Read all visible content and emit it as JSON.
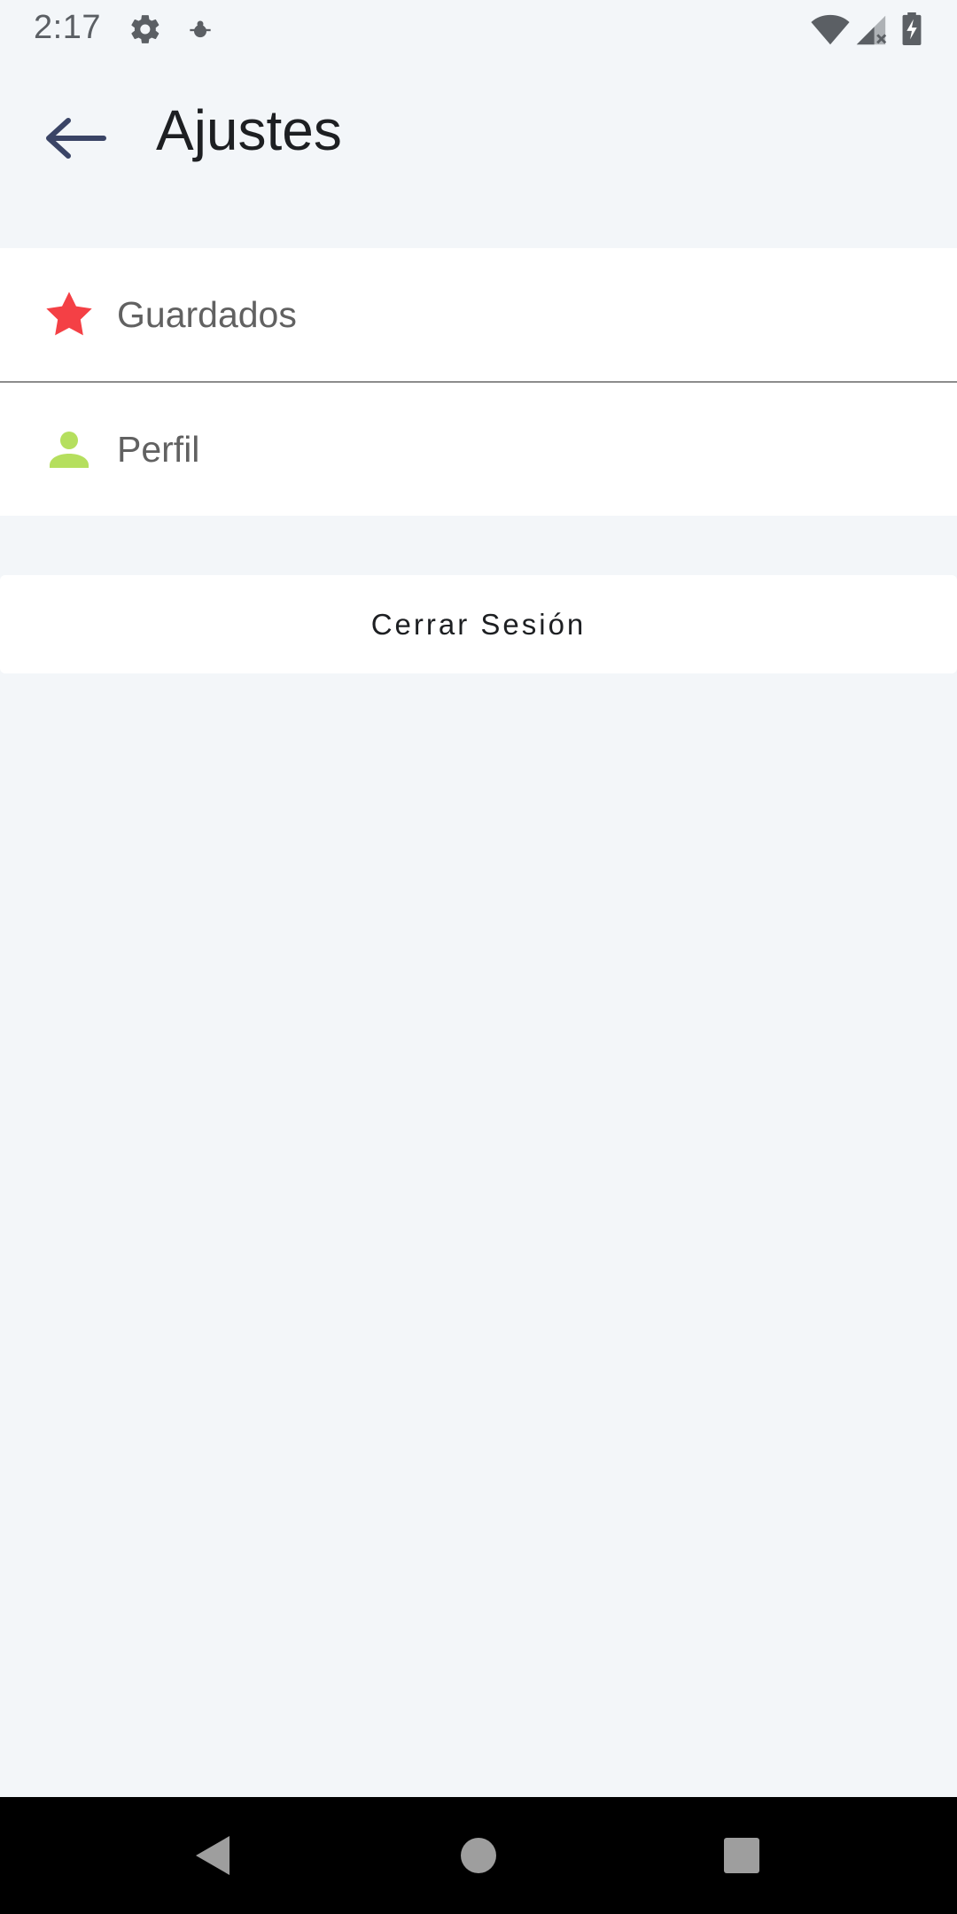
{
  "status_bar": {
    "time": "2:17",
    "icons": [
      "gear-icon",
      "bug-icon",
      "wifi-icon",
      "signal-icon",
      "battery-icon"
    ]
  },
  "app_bar": {
    "title": "Ajustes",
    "back_icon": "arrow-back-icon"
  },
  "menu": {
    "items": [
      {
        "label": "Guardados",
        "icon": "star-icon",
        "icon_color": "#f44045"
      },
      {
        "label": "Perfil",
        "icon": "person-icon",
        "icon_color": "#b5df5e"
      }
    ]
  },
  "logout": {
    "label": "Cerrar Sesión"
  },
  "nav_bar": {
    "buttons": [
      "nav-back-icon",
      "nav-home-icon",
      "nav-recents-icon"
    ]
  },
  "colors": {
    "background": "#f3f6f9",
    "card": "#ffffff",
    "title_text": "#1d1f22",
    "menu_text": "#616161",
    "back_arrow": "#3a4466",
    "star": "#f44045",
    "person": "#b5df5e"
  }
}
